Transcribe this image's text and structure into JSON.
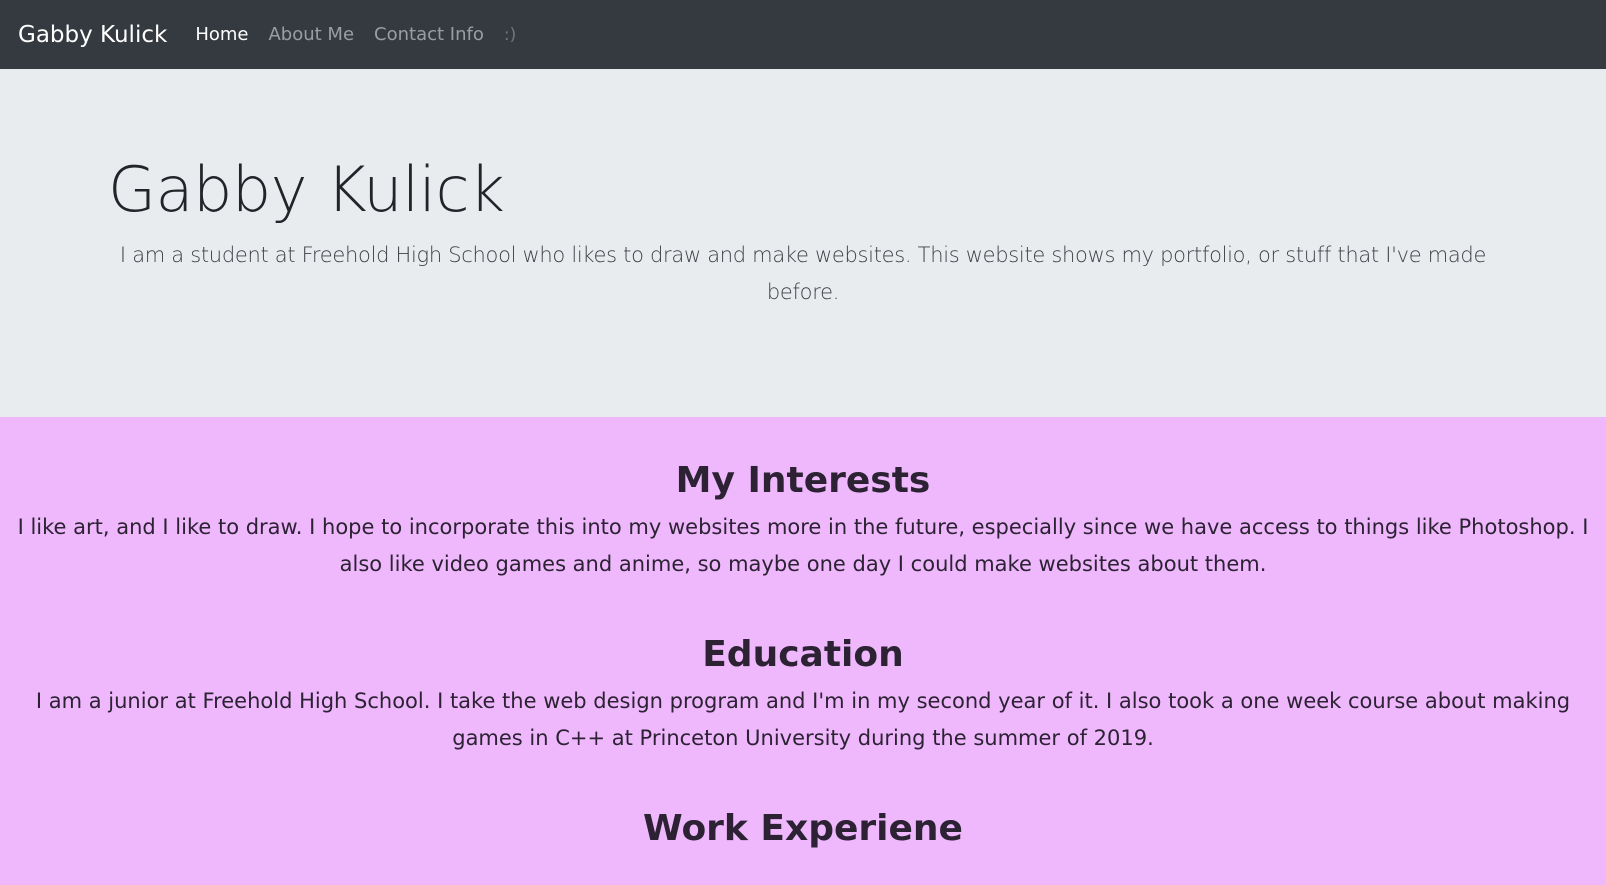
{
  "navbar": {
    "brand": "Gabby Kulick",
    "items": [
      {
        "label": "Home"
      },
      {
        "label": "About Me"
      },
      {
        "label": "Contact Info"
      },
      {
        "label": ":)"
      }
    ]
  },
  "jumbotron": {
    "title": "Gabby Kulick",
    "lead": "I am a student at Freehold High School who likes to draw and make websites. This website shows my portfolio, or stuff that I've made before."
  },
  "sections": [
    {
      "title": "My Interests",
      "text": "I like art, and I like to draw. I hope to incorporate this into my websites more in the future, especially since we have access to things like Photoshop. I also like video games and anime, so maybe one day I could make websites about them."
    },
    {
      "title": "Education",
      "text": "I am a junior at Freehold High School. I take the web design program and I'm in my second year of it. I also took a one week course about making games in C++ at Princeton University during the summer of 2019."
    },
    {
      "title": "Work Experiene",
      "text": ""
    }
  ],
  "colors": {
    "navbar_bg": "#343a40",
    "jumbotron_bg": "#e9ecef",
    "content_bg": "#efb8fc"
  }
}
